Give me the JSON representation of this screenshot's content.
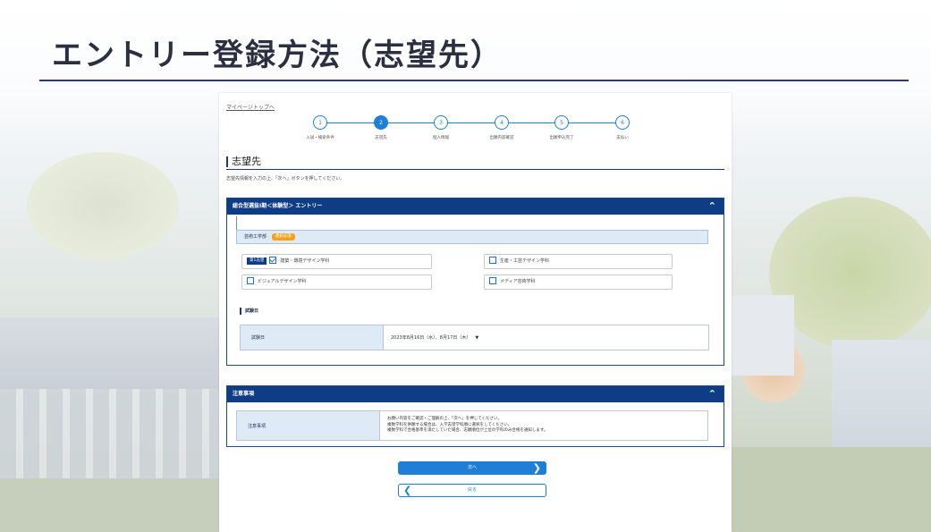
{
  "slide": {
    "title": "エントリー登録方法（志望先）"
  },
  "page": {
    "back_link": "マイページトップへ",
    "steps": [
      {
        "number": "1",
        "label": "入試・検索条件",
        "active": false
      },
      {
        "number": "2",
        "label": "志望先",
        "active": true
      },
      {
        "number": "3",
        "label": "個人情報",
        "active": false
      },
      {
        "number": "4",
        "label": "出願内容確認",
        "active": false
      },
      {
        "number": "5",
        "label": "出願申込完了",
        "active": false
      },
      {
        "number": "6",
        "label": "支払い",
        "active": false
      }
    ],
    "heading": "志望先",
    "instruction": "志望先情報を入力の上、「次へ」ボタンを押してください。",
    "entry_panel": {
      "title": "総合型選抜I期＜体験型＞ エントリー",
      "department": "芸術工学部",
      "required_badge": "選択必須",
      "first_choice_badge": "第1志望",
      "choices": [
        {
          "label": "建築・環境デザイン学科",
          "checked": true
        },
        {
          "label": "生産・工芸デザイン学科",
          "checked": false
        },
        {
          "label": "ビジュアルデザイン学科",
          "checked": false
        },
        {
          "label": "メディア芸術学科",
          "checked": false
        }
      ],
      "exam_date_heading": "試験日",
      "exam_date_label": "試験日",
      "exam_date_value": "2023年8月16日（水）、8月17日（木）"
    },
    "notes_panel": {
      "title": "注意事項",
      "label": "注意事項",
      "lines": [
        "お願い内容をご確認・ご理解の上、「次へ」を押してください。",
        "複数学科を併願する場合は、入学志望学科順に選択をしてください。",
        "複数学科で合格基準を満たしていた場合、志願順位が上位の学科のみ合格を通知します。"
      ]
    },
    "next_button": "次へ",
    "back_button": "戻る"
  },
  "colors": {
    "title": "#2b2f40",
    "panel_header": "#0e3c85",
    "accent": "#1f7fd6",
    "badge_orange": "#f4a21b"
  }
}
